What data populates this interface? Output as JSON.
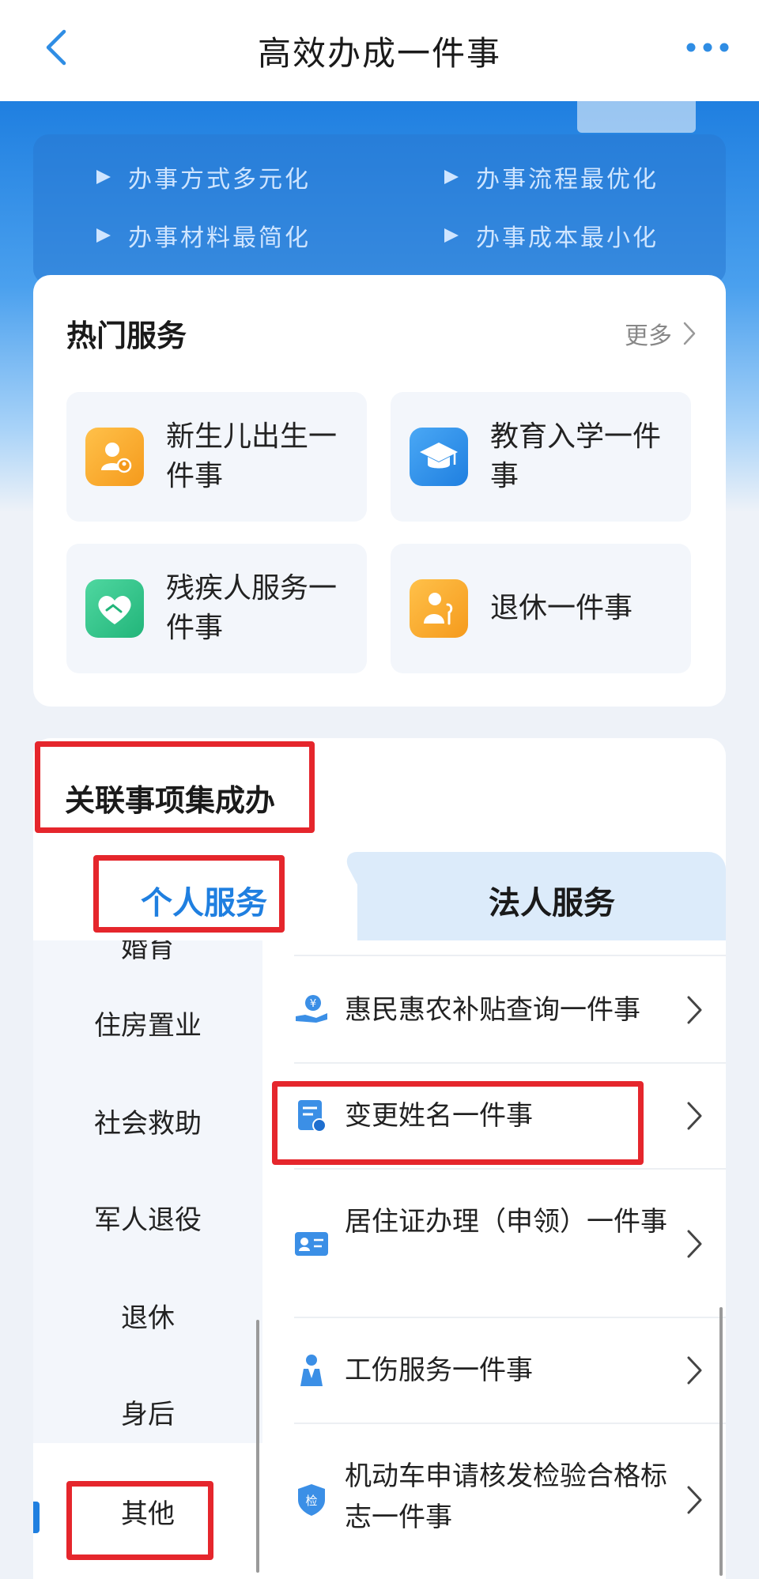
{
  "navbar": {
    "title": "高效办成一件事",
    "back_icon": "chevron-left-icon",
    "more_icon": "more-dots-icon"
  },
  "banner": {
    "slogans": [
      "办事方式多元化",
      "办事流程最优化",
      "办事材料最简化",
      "办事成本最小化"
    ]
  },
  "hot_services": {
    "title": "热门服务",
    "more_label": "更多",
    "items": [
      {
        "label": "新生儿出生一件事",
        "icon": "newborn-icon",
        "color": "#f5a623"
      },
      {
        "label": "教育入学一件事",
        "icon": "graduation-cap-icon",
        "color": "#2f8de4"
      },
      {
        "label": "残疾人服务一件事",
        "icon": "heart-hands-icon",
        "color": "#2ec28a"
      },
      {
        "label": "退休一件事",
        "icon": "retiree-icon",
        "color": "#f5a623"
      }
    ]
  },
  "related": {
    "title": "关联事项集成办",
    "tabs": [
      {
        "label": "个人服务",
        "active": true
      },
      {
        "label": "法人服务",
        "active": false
      }
    ],
    "categories": [
      "婚育",
      "住房置业",
      "社会救助",
      "军人退役",
      "退休",
      "身后",
      "其他"
    ],
    "active_category": "其他",
    "items": [
      {
        "label": "惠民惠农补贴查询一件事",
        "icon": "subsidy-icon"
      },
      {
        "label": "变更姓名一件事",
        "icon": "id-document-icon"
      },
      {
        "label": "居住证办理（申领）一件事",
        "icon": "residence-card-icon"
      },
      {
        "label": "工伤服务一件事",
        "icon": "worker-icon"
      },
      {
        "label": "机动车申请核发检验合格标志一件事",
        "icon": "inspection-shield-icon",
        "badge": "检"
      }
    ]
  },
  "colors": {
    "primary": "#1f7fe0",
    "highlight": "#e5262c",
    "active_tab": "#1f7fe0"
  }
}
